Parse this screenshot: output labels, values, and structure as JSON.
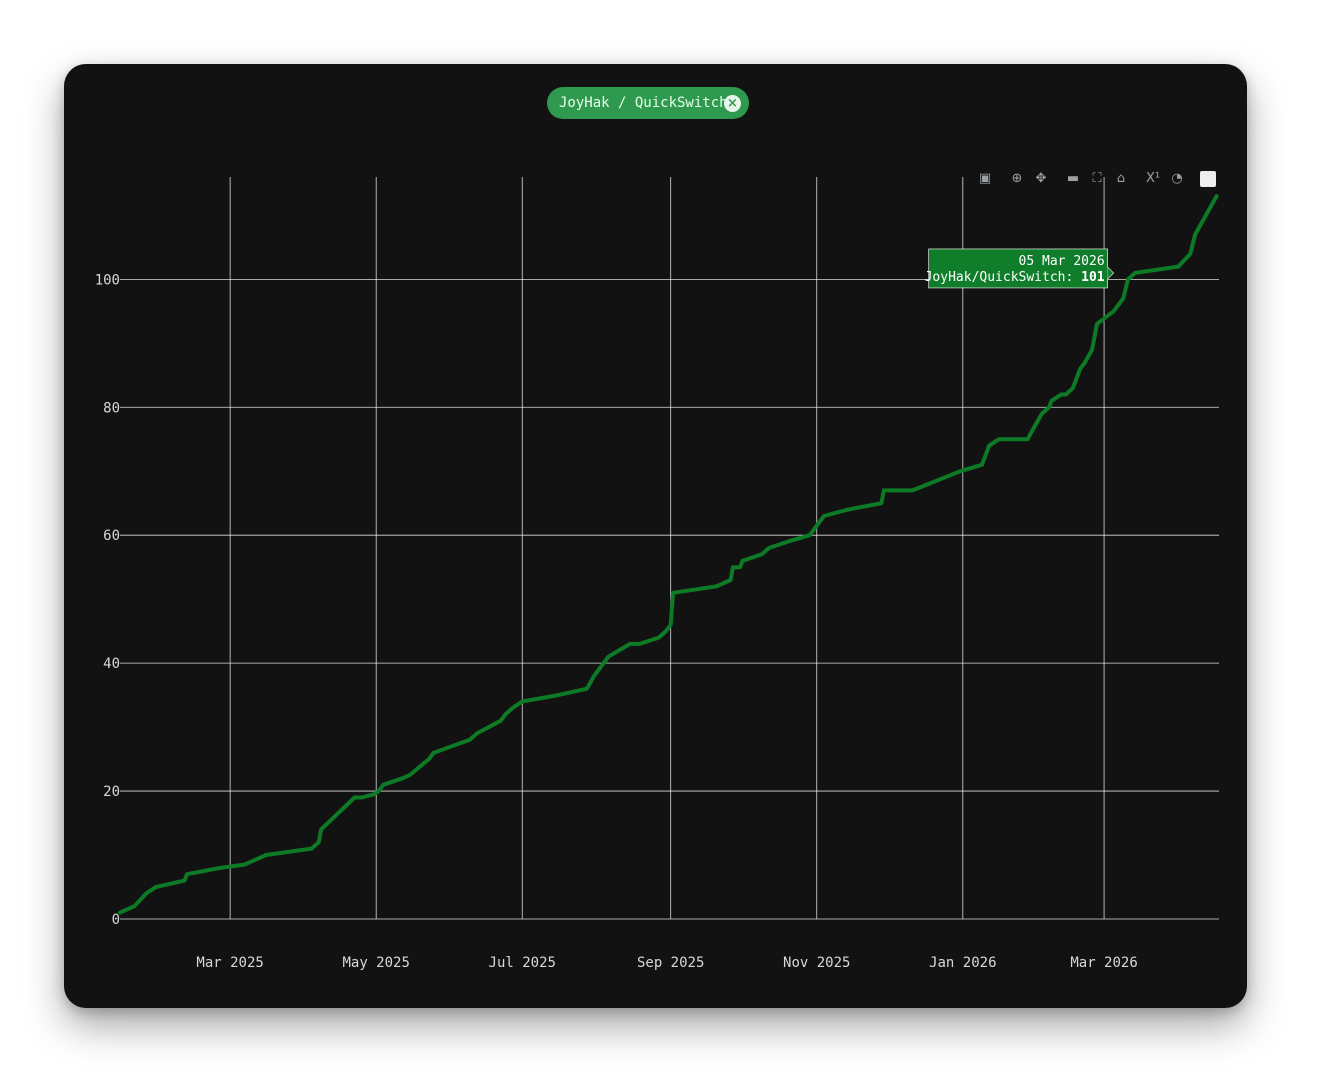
{
  "pill": {
    "label": "JoyHak / QuickSwitch",
    "close_icon": "close-circle-icon"
  },
  "toolbar": {
    "icons": [
      "camera-icon",
      "zoom-icon",
      "pan-icon",
      "zoom-out-icon",
      "autoscale-icon",
      "home-icon",
      "spike-lines-icon",
      "timer-icon",
      "logo-icon"
    ]
  },
  "colors": {
    "line": "#0d7a25",
    "background": "#121212",
    "grid": "#ffffff",
    "pill": "#2f9a4f",
    "tooltip": "#0f7d2a"
  },
  "tooltip": {
    "date": "05 Mar 2026",
    "series": "JoyHak/QuickSwitch:",
    "value": "101"
  },
  "chart_data": {
    "type": "line",
    "title": "",
    "xlabel": "",
    "ylabel": "",
    "x_ticks": [
      "Mar 2025",
      "May 2025",
      "Jul 2025",
      "Sep 2025",
      "Nov 2025",
      "Jan 2026",
      "Mar 2026"
    ],
    "y_ticks": [
      "0",
      "20",
      "40",
      "60",
      "80",
      "100"
    ],
    "xlim": [
      "2025-01-14",
      "2026-04-18"
    ],
    "ylim": [
      0,
      116
    ],
    "grid": true,
    "series": [
      {
        "name": "JoyHak/QuickSwitch",
        "x": [
          "2025-01-14",
          "2025-01-20",
          "2025-01-25",
          "2025-01-29",
          "2025-02-10",
          "2025-02-11",
          "2025-02-18",
          "2025-02-25",
          "2025-03-07",
          "2025-03-16",
          "2025-04-04",
          "2025-04-07",
          "2025-04-08",
          "2025-04-22",
          "2025-04-25",
          "2025-04-30",
          "2025-05-02",
          "2025-05-04",
          "2025-05-12",
          "2025-05-15",
          "2025-05-23",
          "2025-05-25",
          "2025-06-09",
          "2025-06-12",
          "2025-06-22",
          "2025-06-24",
          "2025-06-27",
          "2025-07-01",
          "2025-07-16",
          "2025-07-28",
          "2025-07-31",
          "2025-08-06",
          "2025-08-15",
          "2025-08-19",
          "2025-08-27",
          "2025-08-30",
          "2025-09-01",
          "2025-09-02",
          "2025-09-20",
          "2025-09-26",
          "2025-09-27",
          "2025-09-30",
          "2025-10-01",
          "2025-10-09",
          "2025-10-12",
          "2025-10-20",
          "2025-10-29",
          "2025-10-31",
          "2025-11-04",
          "2025-11-14",
          "2025-11-28",
          "2025-11-29",
          "2025-12-11",
          "2025-12-31",
          "2026-01-09",
          "2026-01-12",
          "2026-01-16",
          "2026-01-28",
          "2026-01-31",
          "2026-02-03",
          "2026-02-06",
          "2026-02-07",
          "2026-02-11",
          "2026-02-13",
          "2026-02-16",
          "2026-02-19",
          "2026-02-21",
          "2026-02-24",
          "2026-02-26",
          "2026-03-05",
          "2026-03-09",
          "2026-03-11",
          "2026-03-14",
          "2026-04-01",
          "2026-04-06",
          "2026-04-08",
          "2026-04-11",
          "2026-04-14",
          "2026-04-17"
        ],
        "y": [
          1,
          2,
          4,
          5,
          6,
          7,
          7.5,
          8,
          8.5,
          10,
          11,
          12,
          14,
          19,
          19,
          19.5,
          20,
          21,
          22,
          22.5,
          25,
          26,
          28,
          29,
          31,
          32,
          33,
          34,
          35,
          36,
          38,
          41,
          43,
          43,
          44,
          45,
          46,
          51,
          52,
          53,
          55,
          55,
          56,
          57,
          58,
          59,
          60,
          61,
          63,
          64,
          65,
          67,
          67,
          70,
          71,
          74,
          75,
          75,
          77,
          79,
          80,
          81,
          82,
          82,
          83,
          86,
          87,
          89,
          93,
          95,
          97,
          100,
          101,
          102,
          104,
          107,
          109,
          111,
          113
        ]
      }
    ],
    "highlight": {
      "x": "2026-03-05",
      "y": 101
    }
  }
}
